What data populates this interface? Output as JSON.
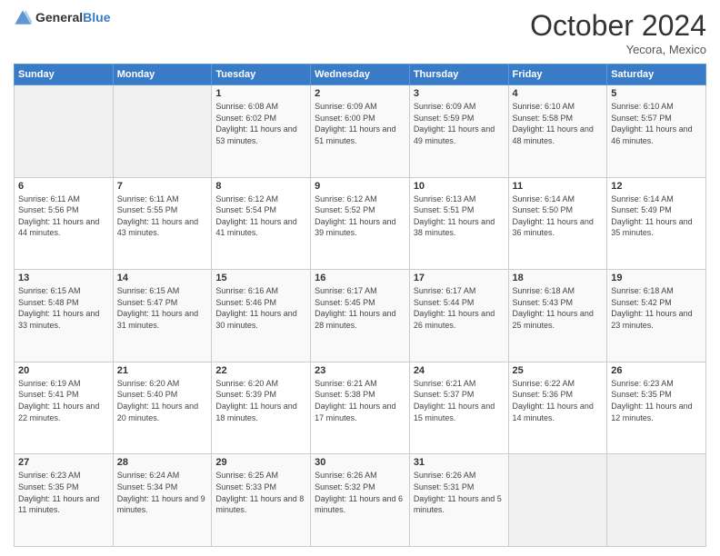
{
  "header": {
    "logo_general": "General",
    "logo_blue": "Blue",
    "month": "October 2024",
    "location": "Yecora, Mexico"
  },
  "weekdays": [
    "Sunday",
    "Monday",
    "Tuesday",
    "Wednesday",
    "Thursday",
    "Friday",
    "Saturday"
  ],
  "weeks": [
    [
      {
        "day": "",
        "sunrise": "",
        "sunset": "",
        "daylight": ""
      },
      {
        "day": "",
        "sunrise": "",
        "sunset": "",
        "daylight": ""
      },
      {
        "day": "1",
        "sunrise": "Sunrise: 6:08 AM",
        "sunset": "Sunset: 6:02 PM",
        "daylight": "Daylight: 11 hours and 53 minutes."
      },
      {
        "day": "2",
        "sunrise": "Sunrise: 6:09 AM",
        "sunset": "Sunset: 6:00 PM",
        "daylight": "Daylight: 11 hours and 51 minutes."
      },
      {
        "day": "3",
        "sunrise": "Sunrise: 6:09 AM",
        "sunset": "Sunset: 5:59 PM",
        "daylight": "Daylight: 11 hours and 49 minutes."
      },
      {
        "day": "4",
        "sunrise": "Sunrise: 6:10 AM",
        "sunset": "Sunset: 5:58 PM",
        "daylight": "Daylight: 11 hours and 48 minutes."
      },
      {
        "day": "5",
        "sunrise": "Sunrise: 6:10 AM",
        "sunset": "Sunset: 5:57 PM",
        "daylight": "Daylight: 11 hours and 46 minutes."
      }
    ],
    [
      {
        "day": "6",
        "sunrise": "Sunrise: 6:11 AM",
        "sunset": "Sunset: 5:56 PM",
        "daylight": "Daylight: 11 hours and 44 minutes."
      },
      {
        "day": "7",
        "sunrise": "Sunrise: 6:11 AM",
        "sunset": "Sunset: 5:55 PM",
        "daylight": "Daylight: 11 hours and 43 minutes."
      },
      {
        "day": "8",
        "sunrise": "Sunrise: 6:12 AM",
        "sunset": "Sunset: 5:54 PM",
        "daylight": "Daylight: 11 hours and 41 minutes."
      },
      {
        "day": "9",
        "sunrise": "Sunrise: 6:12 AM",
        "sunset": "Sunset: 5:52 PM",
        "daylight": "Daylight: 11 hours and 39 minutes."
      },
      {
        "day": "10",
        "sunrise": "Sunrise: 6:13 AM",
        "sunset": "Sunset: 5:51 PM",
        "daylight": "Daylight: 11 hours and 38 minutes."
      },
      {
        "day": "11",
        "sunrise": "Sunrise: 6:14 AM",
        "sunset": "Sunset: 5:50 PM",
        "daylight": "Daylight: 11 hours and 36 minutes."
      },
      {
        "day": "12",
        "sunrise": "Sunrise: 6:14 AM",
        "sunset": "Sunset: 5:49 PM",
        "daylight": "Daylight: 11 hours and 35 minutes."
      }
    ],
    [
      {
        "day": "13",
        "sunrise": "Sunrise: 6:15 AM",
        "sunset": "Sunset: 5:48 PM",
        "daylight": "Daylight: 11 hours and 33 minutes."
      },
      {
        "day": "14",
        "sunrise": "Sunrise: 6:15 AM",
        "sunset": "Sunset: 5:47 PM",
        "daylight": "Daylight: 11 hours and 31 minutes."
      },
      {
        "day": "15",
        "sunrise": "Sunrise: 6:16 AM",
        "sunset": "Sunset: 5:46 PM",
        "daylight": "Daylight: 11 hours and 30 minutes."
      },
      {
        "day": "16",
        "sunrise": "Sunrise: 6:17 AM",
        "sunset": "Sunset: 5:45 PM",
        "daylight": "Daylight: 11 hours and 28 minutes."
      },
      {
        "day": "17",
        "sunrise": "Sunrise: 6:17 AM",
        "sunset": "Sunset: 5:44 PM",
        "daylight": "Daylight: 11 hours and 26 minutes."
      },
      {
        "day": "18",
        "sunrise": "Sunrise: 6:18 AM",
        "sunset": "Sunset: 5:43 PM",
        "daylight": "Daylight: 11 hours and 25 minutes."
      },
      {
        "day": "19",
        "sunrise": "Sunrise: 6:18 AM",
        "sunset": "Sunset: 5:42 PM",
        "daylight": "Daylight: 11 hours and 23 minutes."
      }
    ],
    [
      {
        "day": "20",
        "sunrise": "Sunrise: 6:19 AM",
        "sunset": "Sunset: 5:41 PM",
        "daylight": "Daylight: 11 hours and 22 minutes."
      },
      {
        "day": "21",
        "sunrise": "Sunrise: 6:20 AM",
        "sunset": "Sunset: 5:40 PM",
        "daylight": "Daylight: 11 hours and 20 minutes."
      },
      {
        "day": "22",
        "sunrise": "Sunrise: 6:20 AM",
        "sunset": "Sunset: 5:39 PM",
        "daylight": "Daylight: 11 hours and 18 minutes."
      },
      {
        "day": "23",
        "sunrise": "Sunrise: 6:21 AM",
        "sunset": "Sunset: 5:38 PM",
        "daylight": "Daylight: 11 hours and 17 minutes."
      },
      {
        "day": "24",
        "sunrise": "Sunrise: 6:21 AM",
        "sunset": "Sunset: 5:37 PM",
        "daylight": "Daylight: 11 hours and 15 minutes."
      },
      {
        "day": "25",
        "sunrise": "Sunrise: 6:22 AM",
        "sunset": "Sunset: 5:36 PM",
        "daylight": "Daylight: 11 hours and 14 minutes."
      },
      {
        "day": "26",
        "sunrise": "Sunrise: 6:23 AM",
        "sunset": "Sunset: 5:35 PM",
        "daylight": "Daylight: 11 hours and 12 minutes."
      }
    ],
    [
      {
        "day": "27",
        "sunrise": "Sunrise: 6:23 AM",
        "sunset": "Sunset: 5:35 PM",
        "daylight": "Daylight: 11 hours and 11 minutes."
      },
      {
        "day": "28",
        "sunrise": "Sunrise: 6:24 AM",
        "sunset": "Sunset: 5:34 PM",
        "daylight": "Daylight: 11 hours and 9 minutes."
      },
      {
        "day": "29",
        "sunrise": "Sunrise: 6:25 AM",
        "sunset": "Sunset: 5:33 PM",
        "daylight": "Daylight: 11 hours and 8 minutes."
      },
      {
        "day": "30",
        "sunrise": "Sunrise: 6:26 AM",
        "sunset": "Sunset: 5:32 PM",
        "daylight": "Daylight: 11 hours and 6 minutes."
      },
      {
        "day": "31",
        "sunrise": "Sunrise: 6:26 AM",
        "sunset": "Sunset: 5:31 PM",
        "daylight": "Daylight: 11 hours and 5 minutes."
      },
      {
        "day": "",
        "sunrise": "",
        "sunset": "",
        "daylight": ""
      },
      {
        "day": "",
        "sunrise": "",
        "sunset": "",
        "daylight": ""
      }
    ]
  ]
}
